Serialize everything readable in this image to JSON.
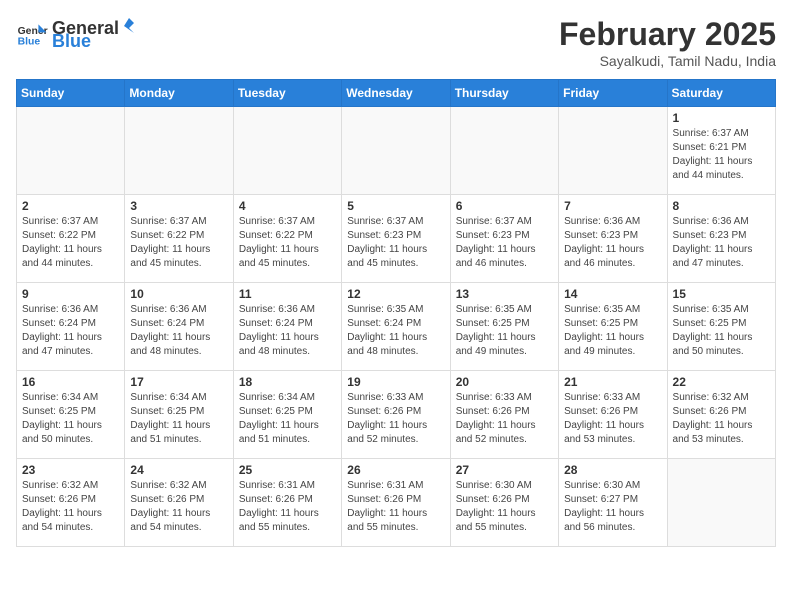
{
  "header": {
    "logo_general": "General",
    "logo_blue": "Blue",
    "title": "February 2025",
    "subtitle": "Sayalkudi, Tamil Nadu, India"
  },
  "weekdays": [
    "Sunday",
    "Monday",
    "Tuesday",
    "Wednesday",
    "Thursday",
    "Friday",
    "Saturday"
  ],
  "weeks": [
    [
      {
        "day": "",
        "info": ""
      },
      {
        "day": "",
        "info": ""
      },
      {
        "day": "",
        "info": ""
      },
      {
        "day": "",
        "info": ""
      },
      {
        "day": "",
        "info": ""
      },
      {
        "day": "",
        "info": ""
      },
      {
        "day": "1",
        "info": "Sunrise: 6:37 AM\nSunset: 6:21 PM\nDaylight: 11 hours\nand 44 minutes."
      }
    ],
    [
      {
        "day": "2",
        "info": "Sunrise: 6:37 AM\nSunset: 6:22 PM\nDaylight: 11 hours\nand 44 minutes."
      },
      {
        "day": "3",
        "info": "Sunrise: 6:37 AM\nSunset: 6:22 PM\nDaylight: 11 hours\nand 45 minutes."
      },
      {
        "day": "4",
        "info": "Sunrise: 6:37 AM\nSunset: 6:22 PM\nDaylight: 11 hours\nand 45 minutes."
      },
      {
        "day": "5",
        "info": "Sunrise: 6:37 AM\nSunset: 6:23 PM\nDaylight: 11 hours\nand 45 minutes."
      },
      {
        "day": "6",
        "info": "Sunrise: 6:37 AM\nSunset: 6:23 PM\nDaylight: 11 hours\nand 46 minutes."
      },
      {
        "day": "7",
        "info": "Sunrise: 6:36 AM\nSunset: 6:23 PM\nDaylight: 11 hours\nand 46 minutes."
      },
      {
        "day": "8",
        "info": "Sunrise: 6:36 AM\nSunset: 6:23 PM\nDaylight: 11 hours\nand 47 minutes."
      }
    ],
    [
      {
        "day": "9",
        "info": "Sunrise: 6:36 AM\nSunset: 6:24 PM\nDaylight: 11 hours\nand 47 minutes."
      },
      {
        "day": "10",
        "info": "Sunrise: 6:36 AM\nSunset: 6:24 PM\nDaylight: 11 hours\nand 48 minutes."
      },
      {
        "day": "11",
        "info": "Sunrise: 6:36 AM\nSunset: 6:24 PM\nDaylight: 11 hours\nand 48 minutes."
      },
      {
        "day": "12",
        "info": "Sunrise: 6:35 AM\nSunset: 6:24 PM\nDaylight: 11 hours\nand 48 minutes."
      },
      {
        "day": "13",
        "info": "Sunrise: 6:35 AM\nSunset: 6:25 PM\nDaylight: 11 hours\nand 49 minutes."
      },
      {
        "day": "14",
        "info": "Sunrise: 6:35 AM\nSunset: 6:25 PM\nDaylight: 11 hours\nand 49 minutes."
      },
      {
        "day": "15",
        "info": "Sunrise: 6:35 AM\nSunset: 6:25 PM\nDaylight: 11 hours\nand 50 minutes."
      }
    ],
    [
      {
        "day": "16",
        "info": "Sunrise: 6:34 AM\nSunset: 6:25 PM\nDaylight: 11 hours\nand 50 minutes."
      },
      {
        "day": "17",
        "info": "Sunrise: 6:34 AM\nSunset: 6:25 PM\nDaylight: 11 hours\nand 51 minutes."
      },
      {
        "day": "18",
        "info": "Sunrise: 6:34 AM\nSunset: 6:25 PM\nDaylight: 11 hours\nand 51 minutes."
      },
      {
        "day": "19",
        "info": "Sunrise: 6:33 AM\nSunset: 6:26 PM\nDaylight: 11 hours\nand 52 minutes."
      },
      {
        "day": "20",
        "info": "Sunrise: 6:33 AM\nSunset: 6:26 PM\nDaylight: 11 hours\nand 52 minutes."
      },
      {
        "day": "21",
        "info": "Sunrise: 6:33 AM\nSunset: 6:26 PM\nDaylight: 11 hours\nand 53 minutes."
      },
      {
        "day": "22",
        "info": "Sunrise: 6:32 AM\nSunset: 6:26 PM\nDaylight: 11 hours\nand 53 minutes."
      }
    ],
    [
      {
        "day": "23",
        "info": "Sunrise: 6:32 AM\nSunset: 6:26 PM\nDaylight: 11 hours\nand 54 minutes."
      },
      {
        "day": "24",
        "info": "Sunrise: 6:32 AM\nSunset: 6:26 PM\nDaylight: 11 hours\nand 54 minutes."
      },
      {
        "day": "25",
        "info": "Sunrise: 6:31 AM\nSunset: 6:26 PM\nDaylight: 11 hours\nand 55 minutes."
      },
      {
        "day": "26",
        "info": "Sunrise: 6:31 AM\nSunset: 6:26 PM\nDaylight: 11 hours\nand 55 minutes."
      },
      {
        "day": "27",
        "info": "Sunrise: 6:30 AM\nSunset: 6:26 PM\nDaylight: 11 hours\nand 55 minutes."
      },
      {
        "day": "28",
        "info": "Sunrise: 6:30 AM\nSunset: 6:27 PM\nDaylight: 11 hours\nand 56 minutes."
      },
      {
        "day": "",
        "info": ""
      }
    ]
  ]
}
